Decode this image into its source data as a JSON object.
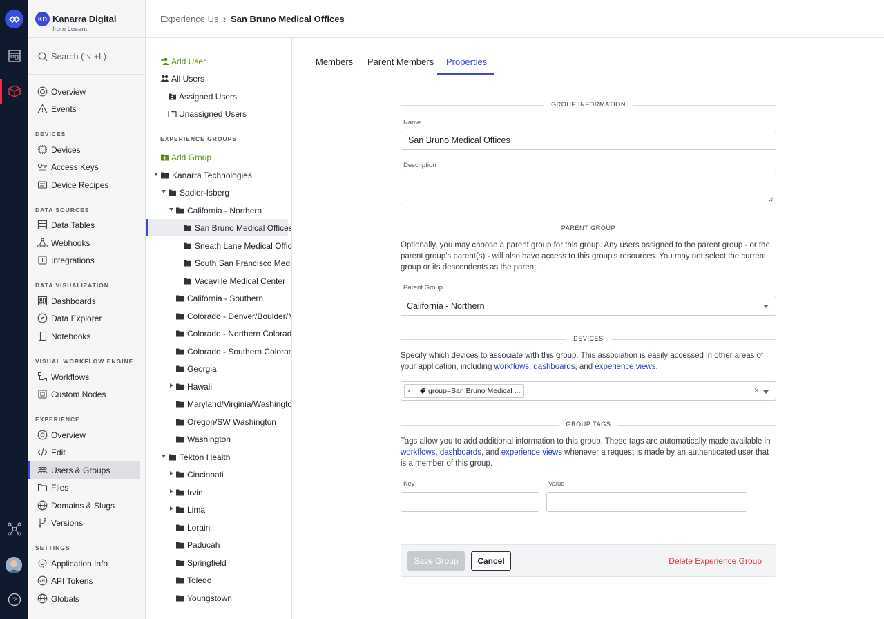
{
  "app": {
    "initials": "KD",
    "name": "Kanarra Digital",
    "from": "from Losant"
  },
  "search": {
    "label": "Search (⌥+L)"
  },
  "nav": {
    "top": [
      {
        "label": "Overview"
      },
      {
        "label": "Events"
      }
    ],
    "devices_title": "DEVICES",
    "devices": [
      {
        "label": "Devices"
      },
      {
        "label": "Access Keys"
      },
      {
        "label": "Device Recipes"
      }
    ],
    "data_sources_title": "DATA SOURCES",
    "data_sources": [
      {
        "label": "Data Tables"
      },
      {
        "label": "Webhooks"
      },
      {
        "label": "Integrations"
      }
    ],
    "data_vis_title": "DATA VISUALIZATION",
    "data_vis": [
      {
        "label": "Dashboards"
      },
      {
        "label": "Data Explorer"
      },
      {
        "label": "Notebooks"
      }
    ],
    "workflow_title": "VISUAL WORKFLOW ENGINE",
    "workflow": [
      {
        "label": "Workflows"
      },
      {
        "label": "Custom Nodes"
      }
    ],
    "experience_title": "EXPERIENCE",
    "experience": [
      {
        "label": "Overview"
      },
      {
        "label": "Edit"
      },
      {
        "label": "Users & Groups"
      },
      {
        "label": "Files"
      },
      {
        "label": "Domains & Slugs"
      },
      {
        "label": "Versions"
      }
    ],
    "settings_title": "SETTINGS",
    "settings": [
      {
        "label": "Application Info"
      },
      {
        "label": "API Tokens"
      },
      {
        "label": "Globals"
      }
    ]
  },
  "breadcrumb": {
    "parent": "Experience Us...",
    "current": "San Bruno Medical Offices"
  },
  "tree": {
    "add_user": "Add User",
    "all_users": "All Users",
    "assigned_users": "Assigned Users",
    "unassigned_users": "Unassigned Users",
    "groups_title": "EXPERIENCE GROUPS",
    "add_group": "Add Group",
    "groups": [
      {
        "label": "Kanarra Technologies"
      },
      {
        "label": "Sadler-Isberg"
      },
      {
        "label": "California - Northern"
      },
      {
        "label": "San Bruno Medical Offices"
      },
      {
        "label": "Sneath Lane Medical Offices"
      },
      {
        "label": "South San Francisco Medical"
      },
      {
        "label": "Vacaville Medical Center"
      },
      {
        "label": "California - Southern"
      },
      {
        "label": "Colorado - Denver/Boulder/Metro"
      },
      {
        "label": "Colorado - Northern Colorado"
      },
      {
        "label": "Colorado - Southern Colorado"
      },
      {
        "label": "Georgia"
      },
      {
        "label": "Hawaii"
      },
      {
        "label": "Maryland/Virginia/Washington"
      },
      {
        "label": "Oregon/SW Washington"
      },
      {
        "label": "Washington"
      },
      {
        "label": "Tekton Health"
      },
      {
        "label": "Cincinnati"
      },
      {
        "label": "Irvin"
      },
      {
        "label": "Lima"
      },
      {
        "label": "Lorain"
      },
      {
        "label": "Paducah"
      },
      {
        "label": "Springfield"
      },
      {
        "label": "Toledo"
      },
      {
        "label": "Youngstown"
      }
    ]
  },
  "tabs": [
    {
      "label": "Members"
    },
    {
      "label": "Parent Members"
    },
    {
      "label": "Properties"
    }
  ],
  "form": {
    "group_info_title": "GROUP INFORMATION",
    "name_label": "Name",
    "name_value": "San Bruno Medical Offices",
    "description_label": "Description",
    "description_value": "",
    "parent_group_title": "PARENT GROUP",
    "parent_help": "Optionally, you may choose a parent group for this group. Any users assigned to the parent group - or the parent group's parent(s) - will also have access to this group's resources. You may not select the current group or its descendents as the parent.",
    "parent_label": "Parent Group",
    "parent_value": "California - Northern",
    "devices_title": "DEVICES",
    "devices_help_1": "Specify which devices to associate with this group. This association is easily accessed in other areas of your application, including ",
    "link_workflows": "workflows",
    "sep_comma": ", ",
    "link_dashboards": "dashboards",
    "sep_and": ", and ",
    "link_experience_views": "experience views",
    "period": ".",
    "device_tag": "group=San Bruno Medical ...",
    "tags_title": "GROUP TAGS",
    "tags_help_1": "Tags allow you to add additional information to this group. These tags are automatically made available in ",
    "tags_help_2": " whenever a request is made by an authenticated user that is a member of this group.",
    "key_label": "Key",
    "value_label": "Value",
    "save_label": "Save Group",
    "cancel_label": "Cancel",
    "delete_label": "Delete Experience Group"
  },
  "colors": {
    "accent": "#3c48d6",
    "rail": "#0f1a2f",
    "danger": "#e0343f",
    "add_green": "#5d8d10",
    "link": "#1f3fc6"
  }
}
